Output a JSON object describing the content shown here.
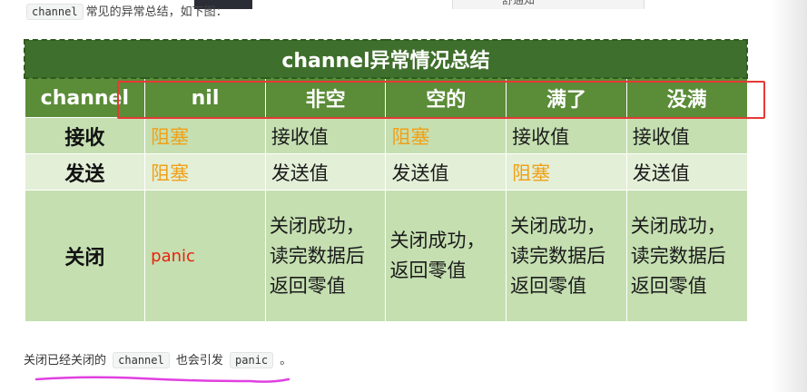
{
  "top_text": {
    "code": "channel",
    "tail": "常见的异常总结，如下图："
  },
  "top_right_fragment": "舒通知",
  "table": {
    "title": "channel异常情况总结",
    "headers": [
      "channel",
      "nil",
      "非空",
      "空的",
      "满了",
      "没满"
    ],
    "rows": [
      {
        "label": "接收",
        "cells": [
          {
            "lines": [
              "阻塞"
            ],
            "kind": "block"
          },
          {
            "lines": [
              "接收值"
            ],
            "kind": "normal"
          },
          {
            "lines": [
              "阻塞"
            ],
            "kind": "block"
          },
          {
            "lines": [
              "接收值"
            ],
            "kind": "normal"
          },
          {
            "lines": [
              "接收值"
            ],
            "kind": "normal"
          }
        ]
      },
      {
        "label": "发送",
        "cells": [
          {
            "lines": [
              "阻塞"
            ],
            "kind": "block"
          },
          {
            "lines": [
              "发送值"
            ],
            "kind": "normal"
          },
          {
            "lines": [
              "发送值"
            ],
            "kind": "normal"
          },
          {
            "lines": [
              "阻塞"
            ],
            "kind": "block"
          },
          {
            "lines": [
              "发送值"
            ],
            "kind": "normal"
          }
        ]
      },
      {
        "label": "关闭",
        "cells": [
          {
            "lines": [
              "panic"
            ],
            "kind": "panic"
          },
          {
            "lines": [
              "关闭成功，",
              "读完数据后",
              "返回零值"
            ],
            "kind": "normal"
          },
          {
            "lines": [
              "关闭成功，",
              "返回零值"
            ],
            "kind": "normal"
          },
          {
            "lines": [
              "关闭成功，",
              "读完数据后",
              "返回零值"
            ],
            "kind": "normal"
          },
          {
            "lines": [
              "关闭成功，",
              "读完数据后",
              "返回零值"
            ],
            "kind": "normal"
          }
        ]
      }
    ]
  },
  "footer": {
    "prefix": "关闭已经关闭的",
    "code1": "channel",
    "middle": "也会引发",
    "code2": "panic",
    "suffix": "。"
  },
  "colors": {
    "title_bg": "#3f6f2c",
    "header_bg": "#5b8c37",
    "row_bg": "#c5dfb1",
    "row_alt_bg": "#e3efd7",
    "block_text": "#f0a11a",
    "panic_text": "#e8230d",
    "highlight_box": "#e53935",
    "underline": "#e040e0"
  }
}
